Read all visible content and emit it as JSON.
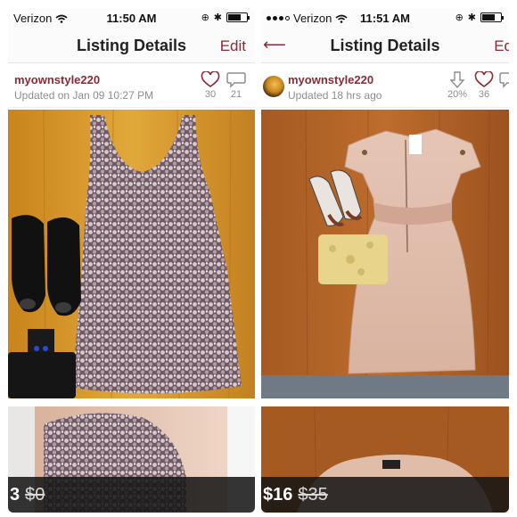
{
  "screens": [
    {
      "status": {
        "carrier": "Verizon",
        "time": "11:50 AM"
      },
      "nav": {
        "title": "Listing Details",
        "edit_label": "Edit"
      },
      "listing": {
        "username": "myownstyle220",
        "updated": "Updated on Jan 09 10:27 PM",
        "likes": "30",
        "comments": "21",
        "price": "3",
        "original_price": "$0"
      }
    },
    {
      "status": {
        "carrier": "Verizon",
        "time": "11:51 AM"
      },
      "nav": {
        "title": "Listing Details",
        "edit_label": "Ed"
      },
      "listing": {
        "username": "myownstyle220",
        "updated": "Updated 18 hrs ago",
        "price_drop": "20%",
        "likes": "36",
        "price": "$16",
        "original_price": "$35"
      }
    }
  ],
  "colors": {
    "accent": "#8a2a35",
    "muted": "#8d8d8d"
  },
  "icons": [
    "wifi-icon",
    "battery-icon",
    "bluetooth-icon",
    "heart-icon",
    "comment-icon",
    "down-arrow-icon",
    "back-arrow-icon"
  ]
}
